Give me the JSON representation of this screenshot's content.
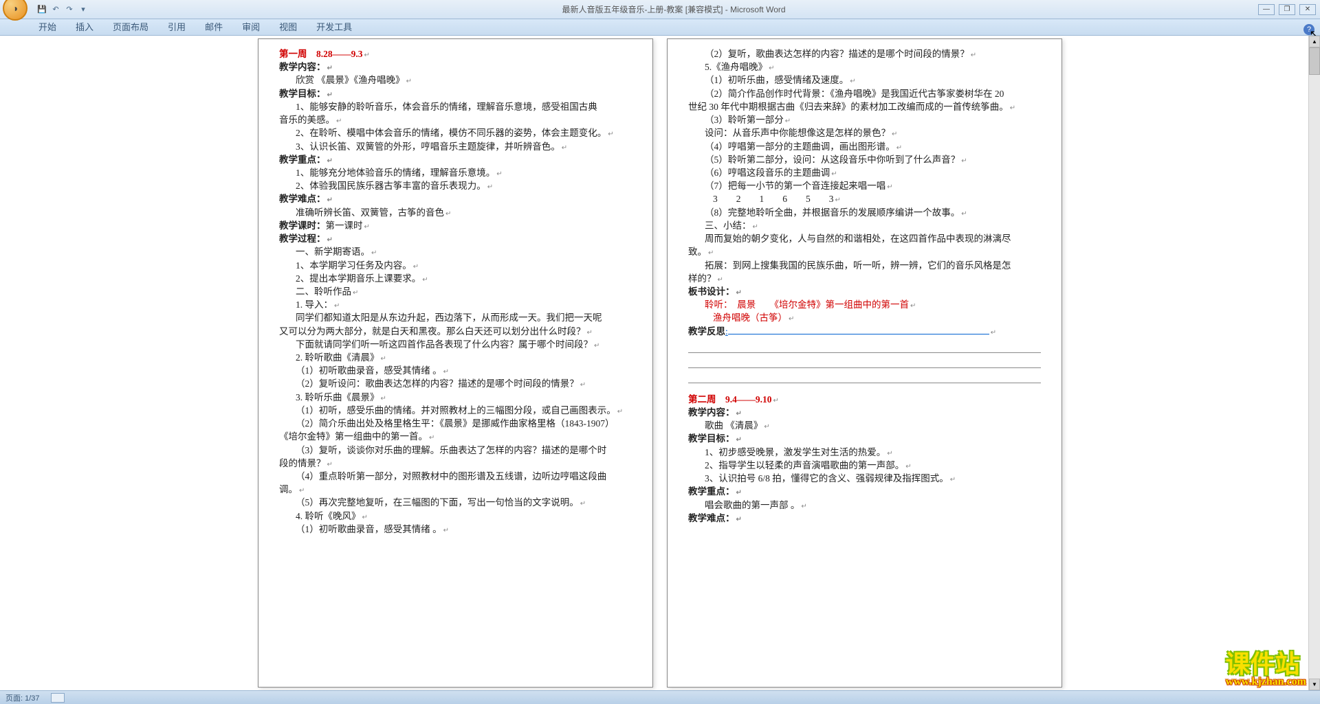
{
  "window": {
    "title": "最新人音版五年级音乐-上册-教案 [兼容模式] - Microsoft Word",
    "min": "—",
    "restore": "❐",
    "close": "✕"
  },
  "tabs": {
    "t1": "开始",
    "t2": "插入",
    "t3": "页面布局",
    "t4": "引用",
    "t5": "邮件",
    "t6": "审阅",
    "t7": "视图",
    "t8": "开发工具"
  },
  "status": {
    "page": "页面: 1/37"
  },
  "watermark": {
    "text": "课件站",
    "url": "www.kjzhan.com"
  },
  "p1": {
    "l01": "第一周　8.28——9.3",
    "l02": "教学内容：",
    "l03": "欣赏 《晨景》《渔舟唱晚》",
    "l04": "教学目标：",
    "l05": "1、能够安静的聆听音乐，体会音乐的情绪，理解音乐意境，感受祖国古典",
    "l06": "音乐的美感。",
    "l07": "2、在聆听、模唱中体会音乐的情绪，模仿不同乐器的姿势，体会主题变化。",
    "l08": "3、认识长笛、双簧管的外形，哼唱音乐主题旋律，并听辨音色。",
    "l09": "教学重点：",
    "l10": "1、能够充分地体验音乐的情绪，理解音乐意境。",
    "l11": "2、体验我国民族乐器古筝丰富的音乐表现力。",
    "l12": "教学难点：",
    "l13": "准确听辨长笛、双簧管，古筝的音色",
    "l14a": "教学课时：",
    "l14b": "第一课时",
    "l15": "教学过程：",
    "l16": "一、新学期寄语。",
    "l17": "1、本学期学习任务及内容。",
    "l18": "2、提出本学期音乐上课要求。",
    "l19": "二、聆听作品",
    "l20": "1. 导入：",
    "l21": "同学们都知道太阳是从东边升起，西边落下，从而形成一天。我们把一天呢",
    "l22": "又可以分为两大部分，就是白天和黑夜。那么白天还可以划分出什么时段？",
    "l23": "下面就请同学们听一听这四首作品各表现了什么内容？属于哪个时间段？",
    "l24": "2. 聆听歌曲《清晨》",
    "l25": "（1）初听歌曲录音，感受其情绪 。",
    "l26": "（2）复听设问：歌曲表达怎样的内容？描述的是哪个时间段的情景？",
    "l27": "3. 聆听乐曲《晨景》",
    "l28": "（1）初听，感受乐曲的情绪。并对照教材上的三幅图分段，或自己画图表示。",
    "l29": "（2）简介乐曲出处及格里格生平：《晨景》是挪威作曲家格里格（1843-1907）",
    "l30": "《培尔金特》第一组曲中的第一首。",
    "l31": "（3）复听，谈谈你对乐曲的理解。乐曲表达了怎样的内容？描述的是哪个时",
    "l32": "段的情景？",
    "l33": "（4）重点聆听第一部分，对照教材中的图形谱及五线谱，边听边哼唱这段曲",
    "l34": "调。",
    "l35": "（5）再次完整地复听，在三幅图的下面，写出一句恰当的文字说明。",
    "l36": "4. 聆听《晚风》",
    "l37": "（1）初听歌曲录音，感受其情绪 。"
  },
  "p2": {
    "l01": "（2）复听，歌曲表达怎样的内容？描述的是哪个时间段的情景？",
    "l02": "5.《渔舟唱晚》",
    "l03": "（1）初听乐曲，感受情绪及速度。",
    "l04": "（2）简介作品创作时代背景：《渔舟唱晚》是我国近代古筝家娄树华在 20",
    "l05": "世纪 30 年代中期根据古曲《归去来辞》的素材加工改编而成的一首传统筝曲。",
    "l06": "（3）聆听第一部分",
    "l07": "设问：从音乐声中你能想像这是怎样的景色？",
    "l08": "（4）哼唱第一部分的主题曲调，画出图形谱。",
    "l09": "（5）聆听第二部分，设问：从这段音乐中你听到了什么声音？",
    "l10": "（6）哼唱这段音乐的主题曲调",
    "l11": "（7）把每一小节的第一个音连接起来唱一唱",
    "l12": "3　　2　　1　　6　　5　　3",
    "l13": "（8）完整地聆听全曲，并根据音乐的发展顺序编讲一个故事。",
    "l14": "三、小结：",
    "l15": "周而复始的朝夕变化，人与自然的和谐相处，在这四首作品中表现的淋漓尽",
    "l16": "致。",
    "l17": "拓展：到网上搜集我国的民族乐曲，听一听，辨一辨，它们的音乐风格是怎",
    "l18": "样的？",
    "l19": "板书设计：",
    "l20": "聆听：　晨景　　《培尔金特》第一组曲中的第一首",
    "l21": "渔舟唱晚（古筝）",
    "l22a": "教学反思",
    "l22b": ":",
    "l23": "第二周　9.4——9.10",
    "l24": "教学内容：",
    "l25": "歌曲 《清晨》",
    "l26": "教学目标：",
    "l27": "1、初步感受晚景，激发学生对生活的热爱。",
    "l28": "2、指导学生以轻柔的声音演唱歌曲的第一声部。",
    "l29": "3、认识拍号 6/8 拍，懂得它的含义、强弱规律及指挥图式。",
    "l30": "教学重点：",
    "l31": "唱会歌曲的第一声部 。",
    "l32": "教学难点："
  }
}
